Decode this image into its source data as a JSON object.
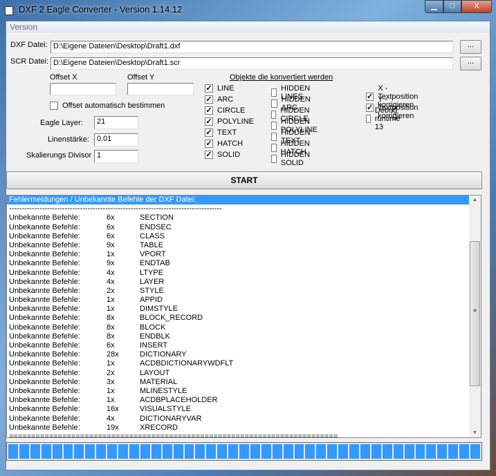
{
  "window": {
    "title": "DXF 2 Eagle Converter - Version 1.14.12",
    "min": "▁",
    "max": "□",
    "close": "X"
  },
  "menu": {
    "version": "Version"
  },
  "files": {
    "dxf_label": "DXF Datei:",
    "dxf_value": "D:\\Eigene Dateien\\Desktop\\Draft1.dxf",
    "scr_label": "SCR Datei:",
    "scr_value": "D:\\Eigene Dateien\\Desktop\\Draft1.scr",
    "browse": "..."
  },
  "offset": {
    "x_label": "Offset X",
    "y_label": "Offset Y",
    "x_value": "",
    "y_value": "",
    "auto_label": "Offset automatisch bestimmen",
    "auto_checked": false
  },
  "params": {
    "layer_label": "Eagle Layer:",
    "layer_value": "21",
    "width_label": "Linenstärke:",
    "width_value": "0.01",
    "divisor_label": "Skalierungs Divisor",
    "divisor_value": "1"
  },
  "objects": {
    "title": "Objekte die konvertiert werden",
    "col1": [
      {
        "label": "LINE",
        "checked": true
      },
      {
        "label": "ARC",
        "checked": true
      },
      {
        "label": "CIRCLE",
        "checked": true
      },
      {
        "label": "POLYLINE",
        "checked": true
      },
      {
        "label": "TEXT",
        "checked": true
      },
      {
        "label": "HATCH",
        "checked": true
      },
      {
        "label": "SOLID",
        "checked": true
      }
    ],
    "col2": [
      {
        "label": "HIDDEN LINES",
        "checked": false
      },
      {
        "label": "HIDDEN ARC",
        "checked": false
      },
      {
        "label": "HIDDEN CIRCLE",
        "checked": false
      },
      {
        "label": "HIDDEN POLYLINE",
        "checked": false
      },
      {
        "label": "HIDDEN TEXT",
        "checked": false
      },
      {
        "label": "HIDDEN HATCH",
        "checked": false
      },
      {
        "label": "HIDDEN SOLID",
        "checked": false
      }
    ],
    "col3": [
      {
        "label": "X - Textposition korrigieren",
        "checked": true
      },
      {
        "label": "Y - Textposition korrigieren",
        "checked": true
      },
      {
        "label": "Debug runtime 13",
        "checked": false
      }
    ]
  },
  "start": "START",
  "log": {
    "header": "Fehlermeldungen / Unbekannte Befehle der DXF Datei:",
    "dash": "------------------------------------------------------------------------------------",
    "footer": "==========================================================================",
    "rows": [
      [
        "Unbekannte Befehle:",
        "6x",
        "SECTION"
      ],
      [
        "Unbekannte Befehle:",
        "6x",
        "ENDSEC"
      ],
      [
        "Unbekannte Befehle:",
        "6x",
        "CLASS"
      ],
      [
        "Unbekannte Befehle:",
        "9x",
        "TABLE"
      ],
      [
        "Unbekannte Befehle:",
        "1x",
        "VPORT"
      ],
      [
        "Unbekannte Befehle:",
        "9x",
        "ENDTAB"
      ],
      [
        "Unbekannte Befehle:",
        "4x",
        "LTYPE"
      ],
      [
        "Unbekannte Befehle:",
        "4x",
        "LAYER"
      ],
      [
        "Unbekannte Befehle:",
        "2x",
        "STYLE"
      ],
      [
        "Unbekannte Befehle:",
        "1x",
        "APPID"
      ],
      [
        "Unbekannte Befehle:",
        "1x",
        "DIMSTYLE"
      ],
      [
        "Unbekannte Befehle:",
        "8x",
        "BLOCK_RECORD"
      ],
      [
        "Unbekannte Befehle:",
        "8x",
        "BLOCK"
      ],
      [
        "Unbekannte Befehle:",
        "8x",
        "ENDBLK"
      ],
      [
        "Unbekannte Befehle:",
        "6x",
        "INSERT"
      ],
      [
        "Unbekannte Befehle:",
        "28x",
        "DICTIONARY"
      ],
      [
        "Unbekannte Befehle:",
        "1x",
        "ACDBDICTIONARYWDFLT"
      ],
      [
        "Unbekannte Befehle:",
        "2x",
        "LAYOUT"
      ],
      [
        "Unbekannte Befehle:",
        "3x",
        "MATERIAL"
      ],
      [
        "Unbekannte Befehle:",
        "1x",
        "MLINESTYLE"
      ],
      [
        "Unbekannte Befehle:",
        "1x",
        "ACDBPLACEHOLDER"
      ],
      [
        "Unbekannte Befehle:",
        "16x",
        "VISUALSTYLE"
      ],
      [
        "Unbekannte Befehle:",
        "4x",
        "DICTIONARYVAR"
      ],
      [
        "Unbekannte Befehle:",
        "19x",
        "XRECORD"
      ]
    ]
  },
  "progress": {
    "percent": 100,
    "segments": 43
  },
  "colors": {
    "selection": "#3399ff",
    "progress": "#3399ff"
  }
}
